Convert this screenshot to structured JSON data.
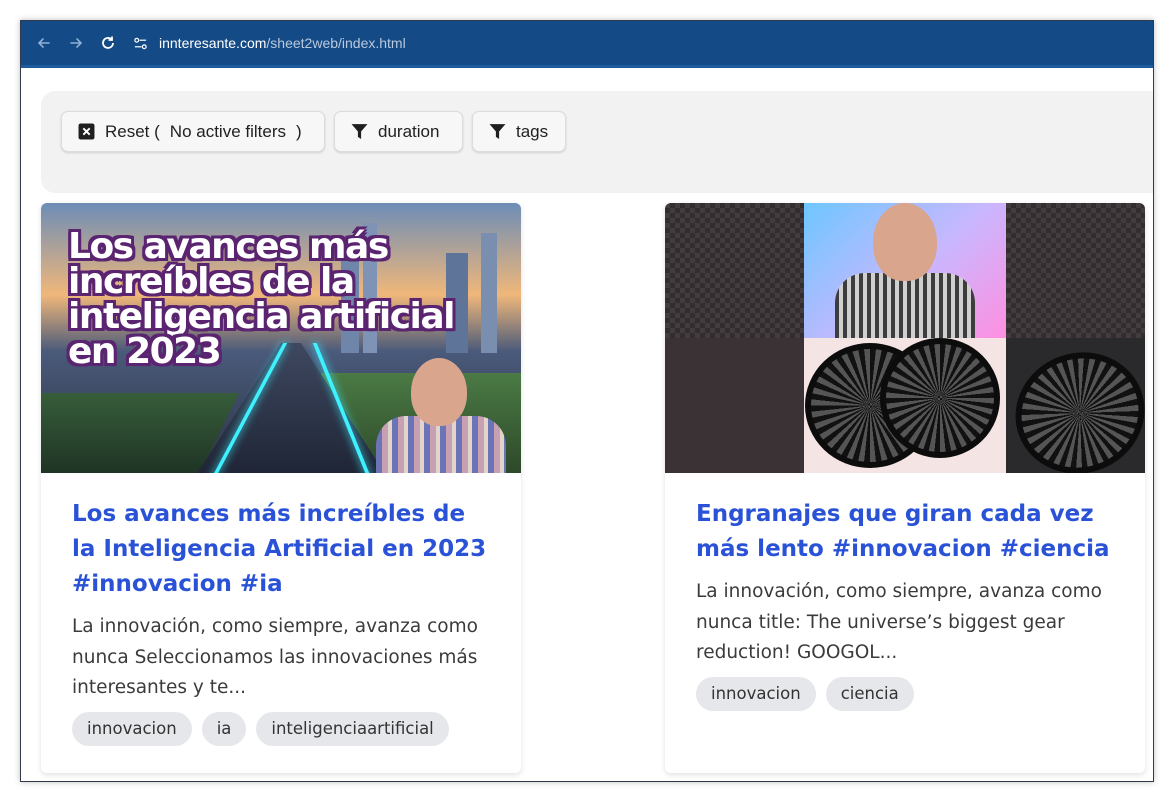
{
  "browser": {
    "url_domain": "innteresante.com",
    "url_path": "/sheet2web/index.html",
    "icons": [
      "back-arrow-icon",
      "forward-arrow-icon",
      "reload-icon",
      "site-settings-icon"
    ]
  },
  "filters": {
    "reset_label": "Reset (",
    "reset_status": "No active filters",
    "reset_close": ")",
    "duration_label": "duration",
    "tags_label": "tags"
  },
  "cards": [
    {
      "thumb_text": "Los avances más increíbles de la inteligencia artificial en 2023",
      "title": "Los avances más increíbles de la Inteligencia Artificial en 2023 #innovacion #ia",
      "description": "La innovación, como siempre, avanza como nunca Seleccionamos las innovaciones más interesantes y te...",
      "tags": [
        "innovacion",
        "ia",
        "inteligenciaartificial"
      ]
    },
    {
      "title": "Engranajes que giran cada vez más lento #innovacion #ciencia",
      "description": "La innovación, como siempre, avanza como nunca title: The universe’s biggest gear reduction! GOOGOL...",
      "tags": [
        "innovacion",
        "ciencia"
      ]
    }
  ],
  "colors": {
    "browser_bar": "#144a85",
    "title_link": "#2a52d6",
    "tag_bg": "#e6e7eb"
  }
}
